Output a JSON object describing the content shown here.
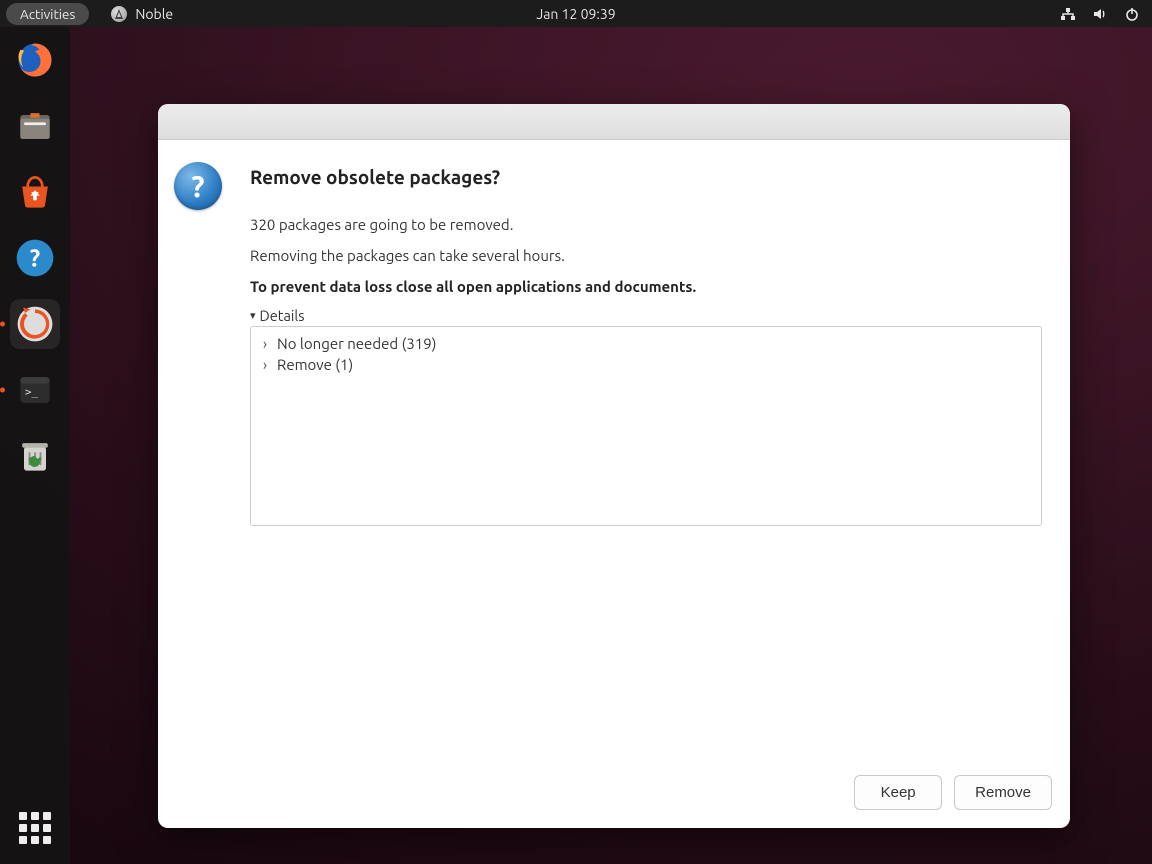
{
  "panel": {
    "activities": "Activities",
    "app_name": "Noble",
    "clock": "Jan 12  09:39"
  },
  "dock": {
    "items": [
      {
        "name": "firefox"
      },
      {
        "name": "files"
      },
      {
        "name": "ubuntu-software"
      },
      {
        "name": "help"
      },
      {
        "name": "software-updater",
        "active": true,
        "running": true
      },
      {
        "name": "terminal",
        "running": true
      },
      {
        "name": "trash"
      }
    ]
  },
  "dialog": {
    "title": "Remove obsolete packages?",
    "line1": "320 packages are going to be removed.",
    "line2": "Removing the packages can take several hours.",
    "warning": "To prevent data loss close all open applications and documents.",
    "details_label": "Details",
    "tree": [
      {
        "label": "No longer needed (319)"
      },
      {
        "label": "Remove (1)"
      }
    ],
    "buttons": {
      "keep": "Keep",
      "remove": "Remove"
    }
  }
}
